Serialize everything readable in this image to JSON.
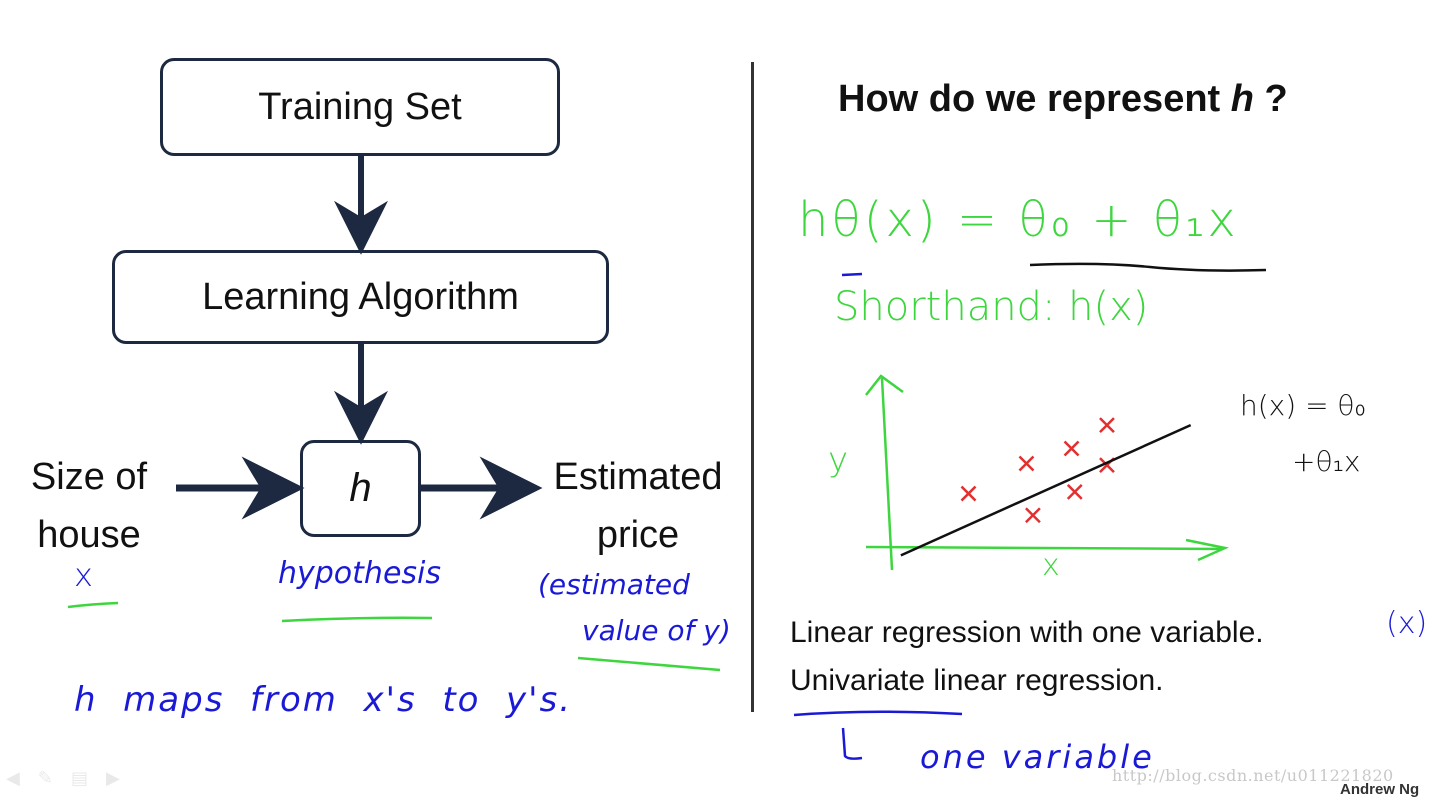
{
  "flowchart": {
    "training_set": "Training Set",
    "learning_algorithm": "Learning Algorithm",
    "hypothesis_symbol": "h",
    "input_label_line1": "Size of",
    "input_label_line2": "house",
    "output_label_line1": "Estimated",
    "output_label_line2": "price"
  },
  "annotations_left": {
    "input_symbol": "x",
    "hypothesis_note": "hypothesis",
    "output_note_line1": "(estimated",
    "output_note_line2": "value of y)",
    "mapping_note": "h  maps  from  x's  to  y's."
  },
  "right_panel": {
    "title_prefix": "How do we represent ",
    "title_symbol": "h",
    "title_suffix": " ?",
    "formula": "hθ(x) = θ₀ + θ₁x",
    "shorthand": "Shorthand: h(x)",
    "plot_line_label_line1": "h(x) = θ₀",
    "plot_line_label_line2": "+θ₁x",
    "bullet1": "Linear regression with one variable.",
    "bullet1_note": "(x)",
    "bullet2": "Univariate linear regression.",
    "bullet2_note": "one variable"
  },
  "chart_data": {
    "type": "scatter",
    "title": "",
    "xlabel": "x",
    "ylabel": "y",
    "grid": false,
    "x_range": [
      0,
      10
    ],
    "y_range": [
      0,
      10
    ],
    "points": [
      {
        "x": 2.5,
        "y": 3.2
      },
      {
        "x": 4.3,
        "y": 5.0
      },
      {
        "x": 4.5,
        "y": 1.9
      },
      {
        "x": 5.7,
        "y": 5.9
      },
      {
        "x": 5.8,
        "y": 3.3
      },
      {
        "x": 6.8,
        "y": 7.3
      },
      {
        "x": 6.8,
        "y": 4.9
      }
    ],
    "fit_line": {
      "label": "h(x) = θ₀ + θ₁x",
      "x": [
        0.4,
        9.4
      ],
      "y": [
        -0.5,
        7.3
      ]
    },
    "colors": {
      "axes": "#3ed63e",
      "points": "#e23030",
      "line": "#111111"
    }
  },
  "footer": {
    "watermark": "http://blog.csdn.net/u011221820",
    "credit": "Andrew Ng",
    "controls": [
      "prev-icon",
      "pen-icon",
      "menu-icon",
      "next-icon"
    ]
  }
}
